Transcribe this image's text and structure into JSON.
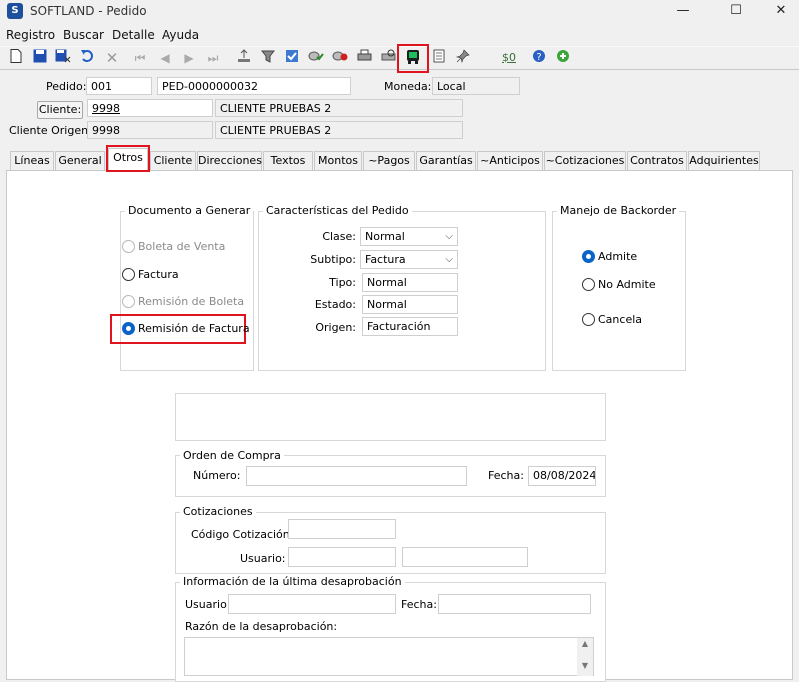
{
  "window": {
    "title": "SOFTLAND - Pedido",
    "minimize": "—",
    "maximize": "☐",
    "close": "✕"
  },
  "menu": [
    "Registro",
    "Buscar",
    "Detalle",
    "Ayuda"
  ],
  "header": {
    "pedido_label": "Pedido:",
    "pedido_value": "001",
    "pedido_number": "PED-0000000032",
    "moneda_label": "Moneda:",
    "moneda_value": "Local",
    "cliente_button": "Cliente:",
    "cliente_value": "9998",
    "cliente_name": "CLIENTE PRUEBAS 2",
    "cliente_origen_label": "Cliente Origen:",
    "cliente_origen_value": "9998",
    "cliente_origen_name": "CLIENTE PRUEBAS 2"
  },
  "tabs": [
    "Líneas",
    "General",
    "Otros",
    "Cliente",
    "Direcciones",
    "Textos",
    "Montos",
    "~Pagos",
    "Garantías",
    "~Anticipos",
    "~Cotizaciones",
    "Contratos",
    "Adquirientes"
  ],
  "documento": {
    "title": "Documento a Generar",
    "options": [
      "Boleta de Venta",
      "Factura",
      "Remisión de Boleta",
      "Remisión de Factura"
    ],
    "selected": "Remisión de Factura"
  },
  "caracteristicas": {
    "title": "Características del Pedido",
    "clase_label": "Clase:",
    "clase_value": "Normal",
    "subtipo_label": "Subtipo:",
    "subtipo_value": "Factura",
    "tipo_label": "Tipo:",
    "tipo_value": "Normal",
    "estado_label": "Estado:",
    "estado_value": "Normal",
    "origen_label": "Origen:",
    "origen_value": "Facturación"
  },
  "backorder": {
    "title": "Manejo de Backorder",
    "options": [
      "Admite",
      "No Admite",
      "Cancela"
    ],
    "selected": "Admite"
  },
  "orden_compra": {
    "title": "Orden de Compra",
    "numero_label": "Número:",
    "numero_value": "",
    "fecha_label": "Fecha:",
    "fecha_value": "08/08/2024"
  },
  "cotizaciones": {
    "title": "Cotizaciones",
    "codigo_label": "Código Cotización:",
    "usuario_label": "Usuario:"
  },
  "desaprobacion": {
    "title": "Información de la última desaprobación",
    "usuario_label": "Usuario:",
    "fecha_label": "Fecha:",
    "razon_label": "Razón de la desaprobación:"
  },
  "icons": {
    "toolbar": [
      "new-icon",
      "save-icon",
      "save-close-icon",
      "undo-icon",
      "delete-icon",
      "first-icon",
      "prev-icon",
      "next-icon",
      "last-icon",
      "upload-icon",
      "filter-icon",
      "check-icon",
      "approve-icon",
      "reject-icon",
      "print-icon",
      "print-preview-icon",
      "highlighted-device-icon",
      "calculator-icon",
      "pin-icon",
      "quantity-icon",
      "help-icon",
      "add-icon"
    ]
  },
  "colors": {
    "accent": "#0a64c8",
    "highlight": "#e0141e"
  }
}
